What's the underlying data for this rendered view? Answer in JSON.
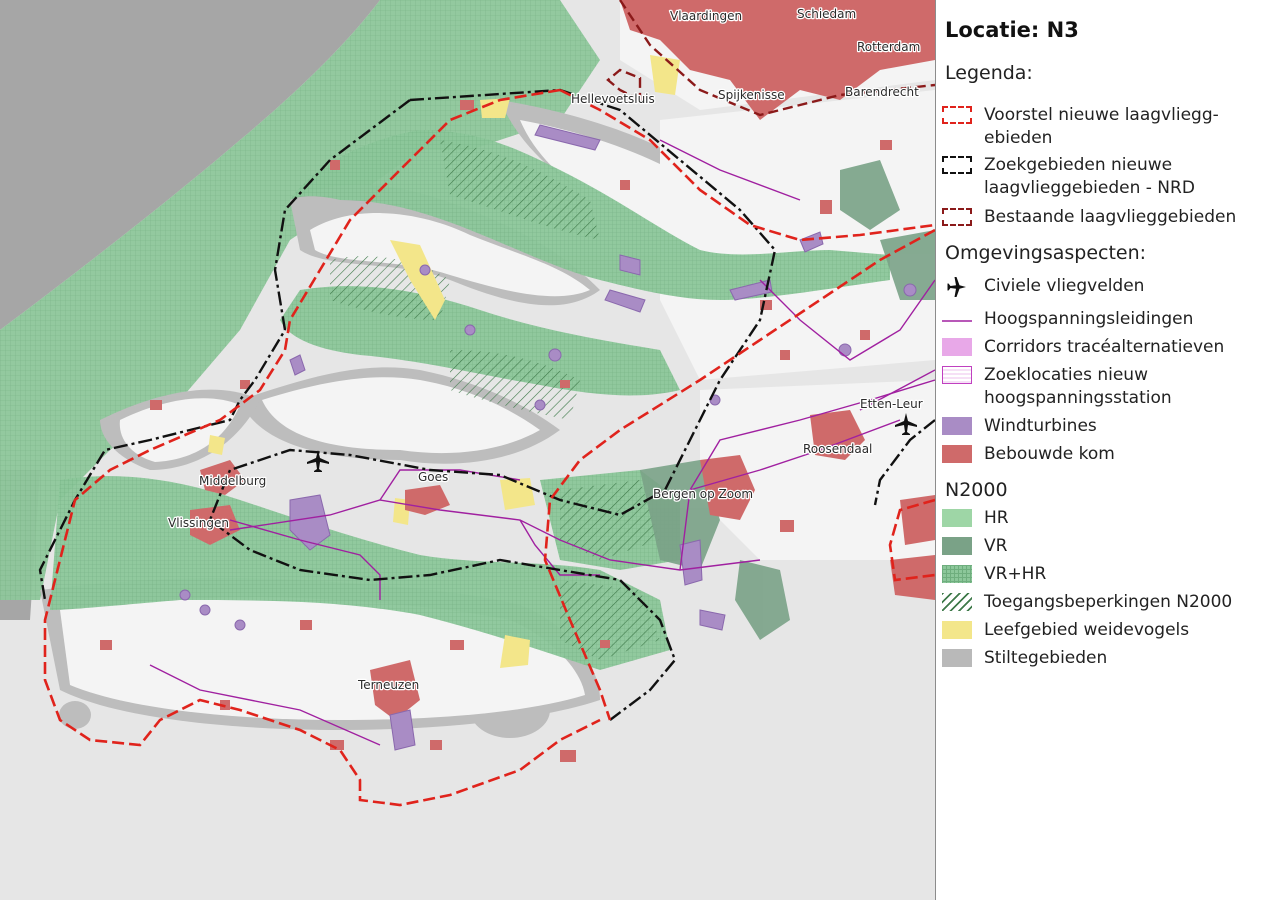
{
  "legend": {
    "title": "Locatie: N3",
    "legenda_heading": "Legenda:",
    "items_legenda": [
      {
        "label": "Voorstel nieuwe laagvliegg­ebieden",
        "color": "#e0231c",
        "icon": "red-dashed-box-icon"
      },
      {
        "label": "Zoekgebieden nieuwe laagvlieggebieden - NRD",
        "color": "#111111",
        "icon": "black-dashed-box-icon"
      },
      {
        "label": "Bestaande laagvlieggebieden",
        "color": "#8b1a1a",
        "icon": "darkred-dashed-box-icon"
      }
    ],
    "omgeving_heading": "Omgevingsaspecten:",
    "items_omgeving": [
      {
        "label": "Civiele vliegvelden",
        "color": "#111111",
        "icon": "airplane-icon"
      },
      {
        "label": "Hoogspanningsleidingen",
        "color": "#a020a0",
        "icon": "power-line-icon"
      },
      {
        "label": "Corridors tracéalternatieven",
        "color": "#e8a8e8",
        "icon": "corridor-fill-icon"
      },
      {
        "label": "Zoeklocaties nieuw hoogspanningsstation",
        "color": "#c040c0",
        "icon": "station-hatched-icon"
      },
      {
        "label": "Windturbines",
        "color": "#a98cc5",
        "icon": "windturbine-fill-icon"
      },
      {
        "label": "Bebouwde kom",
        "color": "#cf6a6a",
        "icon": "builtup-fill-icon"
      }
    ],
    "n2000_heading": "N2000",
    "items_n2000": [
      {
        "label": "HR",
        "color": "#9ed6a6",
        "icon": "hr-fill-icon"
      },
      {
        "label": "VR",
        "color": "#7aa287",
        "icon": "vr-fill-icon"
      },
      {
        "label": "VR+HR",
        "color": "#7fbf8c",
        "icon": "vrhr-grid-icon"
      },
      {
        "label": "Toegangsbeperkingen N2000",
        "color": "#3f7a4a",
        "icon": "diagonal-hatch-icon"
      },
      {
        "label": "Leefgebied weidevogels",
        "color": "#f3e68a",
        "icon": "meadowbird-fill-icon"
      },
      {
        "label": "Stiltegebieden",
        "color": "#b9b9b9",
        "icon": "quiet-area-fill-icon"
      }
    ]
  },
  "map": {
    "places": [
      {
        "name": "Vlaardingen"
      },
      {
        "name": "Schiedam"
      },
      {
        "name": "Rotterdam"
      },
      {
        "name": "Hellevoetsluis"
      },
      {
        "name": "Spijkenisse"
      },
      {
        "name": "Barendrecht"
      },
      {
        "name": "Etten-Leur"
      },
      {
        "name": "Roosendaal"
      },
      {
        "name": "Middelburg"
      },
      {
        "name": "Goes"
      },
      {
        "name": "Vlissingen"
      },
      {
        "name": "Bergen op Zoom"
      },
      {
        "name": "Terneuzen"
      }
    ],
    "colors": {
      "sea": "#a6a6a6",
      "land": "#e6e6e6",
      "island_land": "#f2f2f2",
      "quiet_area": "#bdbdbd",
      "n2000_vrhr": "#84c292",
      "n2000_vr": "#7aa287",
      "builtup": "#cf6a6a",
      "windturbine": "#a98cc5",
      "powerline": "#a020a0",
      "meadowbird": "#f3e68a",
      "proposal_red": "#e0231c",
      "search_black": "#111111",
      "existing_darkred": "#8b1a1a"
    }
  }
}
